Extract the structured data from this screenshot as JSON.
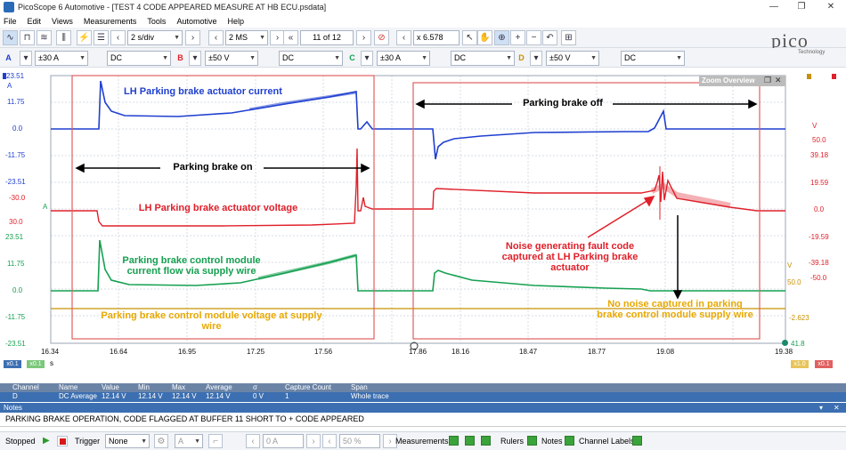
{
  "window": {
    "title": "PicoScope 6 Automotive - [TEST 4 CODE APPEARED MEASURE AT HB ECU.psdata]",
    "controls": [
      "—",
      "❐",
      "✕"
    ]
  },
  "menu": [
    "File",
    "Edit",
    "Views",
    "Measurements",
    "Tools",
    "Automotive",
    "Help"
  ],
  "toolbar": {
    "timebase": "2 s/div",
    "samples": "2 MS",
    "buffer": "11 of 12",
    "zoom": "x 6.578",
    "logo": "pico",
    "logo_sub": "Technology"
  },
  "channels": [
    {
      "letter": "A",
      "range": "±30 A",
      "coupling": "DC",
      "color": "#1f3fd0"
    },
    {
      "letter": "B",
      "range": "±50 V",
      "coupling": "DC",
      "color": "#e0202a"
    },
    {
      "letter": "C",
      "range": "±30 A",
      "coupling": "DC",
      "color": "#15a050"
    },
    {
      "letter": "D",
      "range": "±50 V",
      "coupling": "DC",
      "color": "#d8a010"
    }
  ],
  "plot": {
    "left_axis_a": {
      "unit": "A",
      "top": "23.51",
      "ticks": [
        "11.75",
        "0.0",
        "-11.75",
        "-23.51"
      ]
    },
    "left_axis_b": {
      "unit": "A",
      "top": "-30.0",
      "ticks": [
        "30.0"
      ]
    },
    "left_axis_c": {
      "ticks": [
        "23.51",
        "11.75",
        "0.0",
        "-11.75",
        "-23.51"
      ]
    },
    "right_axis_b": {
      "unit": "V",
      "ticks": [
        "50.0",
        "39.18",
        "19.59",
        "0.0",
        "-19.59",
        "-39.18",
        "-50.0"
      ]
    },
    "right_axis_d": {
      "unit": "V",
      "ticks": [
        "50.0",
        "-2.623",
        "41.8"
      ]
    },
    "x_ticks": [
      "16.34",
      "16.64",
      "16.95",
      "17.25",
      "17.56",
      "17.86",
      "18.16",
      "18.47",
      "18.77",
      "19.08",
      "19.38"
    ],
    "x_unit": "s",
    "x_left_badge": "x0.1",
    "x_left_badge2": "x0.1",
    "x_right_badge": "x1.0",
    "x_right_badge2": "x0.1",
    "zoom_overview": "Zoom Overview",
    "annotations": {
      "lh_current": "LH Parking brake actuator current",
      "brake_on": "Parking brake on",
      "lh_voltage": "LH Parking brake actuator voltage",
      "module_current": "Parking brake control module current flow via supply wire",
      "module_voltage": "Parking brake control module voltage at supply wire",
      "brake_off": "Parking brake off",
      "noise": "Noise generating fault code captured at LH Parking brake actuator",
      "no_noise": "No noise captured in parking brake control module supply wire"
    }
  },
  "measurements": {
    "headers": [
      "Channel",
      "Name",
      "Value",
      "Min",
      "Max",
      "Average",
      "σ",
      "Capture Count",
      "Span"
    ],
    "row": [
      "D",
      "DC Average",
      "12.14 V",
      "12.14 V",
      "12.14 V",
      "12.14 V",
      "0 V",
      "1",
      "Whole trace"
    ]
  },
  "notes": {
    "title": "Notes",
    "text": "PARKING BRAKE OPERATION, CODE FLAGGED AT BUFFER 11 SHORT TO + CODE APPEARED"
  },
  "status": {
    "state": "Stopped",
    "trigger_label": "Trigger",
    "trigger_mode": "None",
    "trigger_channel": "A",
    "trigger_level": "0 A",
    "trigger_pct": "50 %",
    "measurements": "Measurements",
    "rulers": "Rulers",
    "notes": "Notes",
    "channel_labels": "Channel Labels"
  },
  "colors": {
    "accent": "#3c6fb1",
    "box": "#e06060"
  }
}
